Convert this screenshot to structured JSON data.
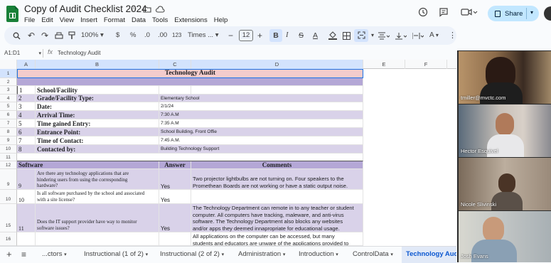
{
  "app": {
    "title": "Copy of Audit Checklist 2024"
  },
  "menu": [
    "File",
    "Edit",
    "View",
    "Insert",
    "Format",
    "Data",
    "Tools",
    "Extensions",
    "Help"
  ],
  "header": {
    "share_label": "Share"
  },
  "toolbar": {
    "zoom": "100%",
    "currency": "$",
    "percent": "%",
    "dec_less": ".0",
    "dec_more": ".00",
    "more_formats": "123",
    "font": "Times ...",
    "font_size": "12"
  },
  "formula": {
    "name_box": "A1:D1",
    "fx": "fx",
    "value": "Technology Audit"
  },
  "columns": [
    "A",
    "B",
    "C",
    "D",
    "E",
    "F"
  ],
  "rows": {
    "r1": "1",
    "r2": "2",
    "r3": "3",
    "r4": "4",
    "r5": "5",
    "r6": "6",
    "r7": "7",
    "r8": "8",
    "r9": "9",
    "r10": "10",
    "r11": "11",
    "r12": "12",
    "r13": "9",
    "r14": "10",
    "r15": "15",
    "r16": "16"
  },
  "sheet": {
    "title": "Technology Audit",
    "info_items": [
      {
        "num": "1",
        "label": "School/Facility",
        "value": ""
      },
      {
        "num": "2",
        "label": "Grade/Facility Type:",
        "value": "Elementary School"
      },
      {
        "num": "3",
        "label": "Date:",
        "value": "2/1/24"
      },
      {
        "num": "4",
        "label": "Arrival Time:",
        "value": "7:30 A.M"
      },
      {
        "num": "5",
        "label": "Time gained Entry:",
        "value": "7:35 A.M"
      },
      {
        "num": "6",
        "label": "Entrance Point:",
        "value": "School Building, Front Offie"
      },
      {
        "num": "7",
        "label": "Time of Contact:",
        "value": "7:45 A.M."
      },
      {
        "num": "8",
        "label": "Contacted by:",
        "value": "Building Technology Support"
      }
    ],
    "section_header": {
      "col_b": "Software",
      "col_c": "Answer",
      "col_d": "Comments"
    },
    "questions": [
      {
        "num": "9",
        "q1": "Are there any technology applications that are",
        "q2": "hindering users from using the corresponding",
        "q3": "hardware?",
        "answer": "Yes",
        "c1": "Two projector lightbulbs are not turning on. Four speakers to the",
        "c2": "Promethean Boards are not working or have a static output noise."
      },
      {
        "num": "10",
        "q1": "Is all software purchased by the school and associated",
        "q2": "with a site license?",
        "answer": "Yes"
      },
      {
        "num": "11",
        "q1": "Does the IT support provider have way to monitor",
        "q2": "software issues?",
        "answer": "Yes",
        "c1": "The Technology Department can remote in to any teacher or student",
        "c2": "computer. All computers have tracking, maleware, and anti-virus",
        "c3": "software. The Technology Department also blocks any websites",
        "c4": "and/or apps they deemed innapropriate for educational usage."
      },
      {
        "c1": "All applications on the computer can be accessed, but many",
        "c2": "students and educators are unware of the applications provided to"
      }
    ]
  },
  "tabs": [
    "...ctors",
    "Instructional (1 of 2)",
    "Instructional (2 of 2)",
    "Administration",
    "Introduction",
    "ControlData",
    "Technology Audit"
  ],
  "participants": [
    "tmiller@mvctc.com",
    "Hector Esquivel",
    "Nicole Slivinski",
    "Josh Evans"
  ],
  "colors": {
    "title_row": "#f4cccc",
    "section_row": "#b4a7d6",
    "info_row": "#d9d2e9",
    "selection": "#1a73e8",
    "sheets_green": "#188038"
  }
}
